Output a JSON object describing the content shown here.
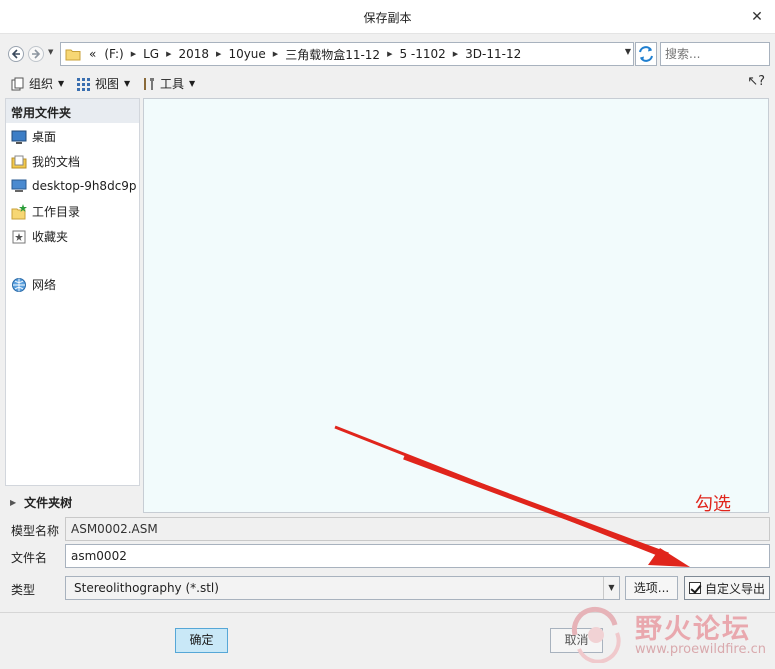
{
  "window": {
    "title": "保存副本"
  },
  "address": {
    "crumbs": [
      "«",
      "(F:)",
      "LG",
      "2018",
      "10yue",
      "三角载物盒11-12",
      "5 -1102",
      "3D-11-12"
    ]
  },
  "search": {
    "placeholder": "搜索..."
  },
  "toolbar": {
    "organize": "组织",
    "view": "视图",
    "tools": "工具"
  },
  "sidebar": {
    "header": "常用文件夹",
    "items": [
      {
        "label": "桌面",
        "icon": "desktop-icon"
      },
      {
        "label": "我的文档",
        "icon": "documents-icon"
      },
      {
        "label": "desktop-9h8dc9p",
        "icon": "computer-icon"
      },
      {
        "label": "工作目录",
        "icon": "working-directory-icon"
      },
      {
        "label": "收藏夹",
        "icon": "favorites-icon"
      },
      {
        "label": "网络",
        "icon": "network-icon"
      }
    ]
  },
  "folder_tree": {
    "label": "文件夹树"
  },
  "form": {
    "model_name_label": "模型名称",
    "model_name_value": "ASM0002.ASM",
    "file_name_label": "文件名",
    "file_name_value": "asm0002",
    "type_label": "类型",
    "type_value": "Stereolithography (*.stl)",
    "options_label": "选项...",
    "custom_export_label": "自定义导出",
    "custom_export_checked": true
  },
  "buttons": {
    "ok": "确定",
    "cancel": "取消"
  },
  "annotation": {
    "text": "勾选",
    "color": "#e0251c"
  },
  "watermark": {
    "name": "野火论坛",
    "url": "www.proewildfire.cn"
  }
}
